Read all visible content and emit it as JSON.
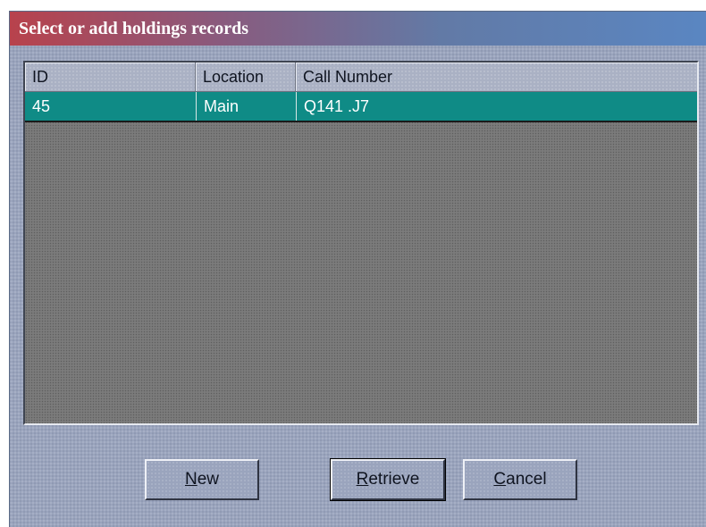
{
  "window": {
    "title": "Select or add holdings records"
  },
  "table": {
    "columns": [
      "ID",
      "Location",
      "Call Number"
    ],
    "rows": [
      {
        "id": "45",
        "location": "Main",
        "call_number": "Q141 .J7",
        "selected": true
      }
    ]
  },
  "buttons": {
    "new": {
      "mnemonic": "N",
      "rest": "ew"
    },
    "retrieve": {
      "mnemonic": "R",
      "rest": "etrieve"
    },
    "cancel": {
      "mnemonic": "C",
      "rest": "ancel"
    }
  },
  "colors": {
    "selection": "#0f8b86",
    "dialog_background": "#9aa4bd",
    "list_background": "#7b7b7b",
    "title_gradient_start": "#b8424c",
    "title_gradient_end": "#5a86c2"
  }
}
